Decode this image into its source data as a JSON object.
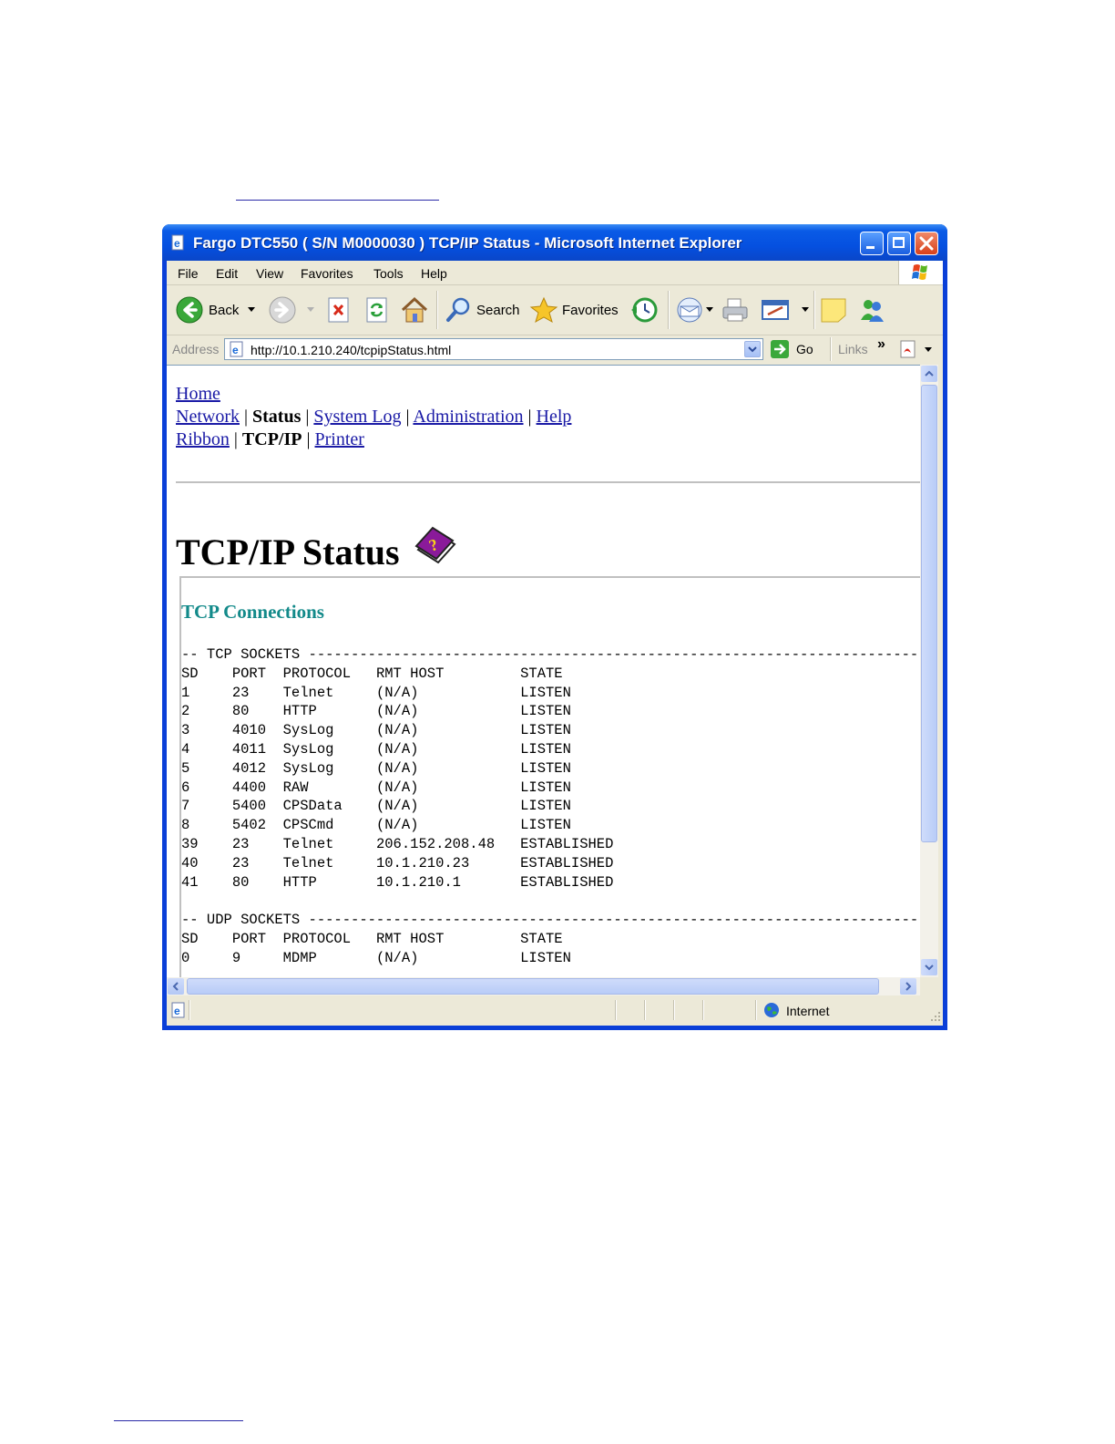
{
  "window": {
    "title": "Fargo DTC550 ( S/N M0000030 ) TCP/IP Status - Microsoft Internet Explorer"
  },
  "menu": [
    "File",
    "Edit",
    "View",
    "Favorites",
    "Tools",
    "Help"
  ],
  "toolbar": {
    "back_label": "Back",
    "search_label": "Search",
    "favorites_label": "Favorites"
  },
  "address": {
    "label": "Address",
    "url": "http://10.1.210.240/tcpipStatus.html",
    "go_label": "Go",
    "links_label": "Links",
    "chevron": "»"
  },
  "nav": {
    "home": "Home",
    "row2": {
      "network": "Network",
      "status": "Status",
      "system_log": "System Log",
      "administration": "Administration",
      "help": "Help"
    },
    "row3": {
      "ribbon": "Ribbon",
      "tcpip": "TCP/IP",
      "printer": "Printer"
    },
    "sep": "|"
  },
  "page": {
    "title": "TCP/IP Status",
    "section": "TCP Connections"
  },
  "tcp_sockets": {
    "heading": "-- TCP SOCKETS ------------------------------------------------------------------------",
    "columns": [
      "SD",
      "PORT",
      "PROTOCOL",
      "RMT HOST",
      "STATE"
    ],
    "rows": [
      [
        "1",
        "23",
        "Telnet",
        "(N/A)",
        "LISTEN"
      ],
      [
        "2",
        "80",
        "HTTP",
        "(N/A)",
        "LISTEN"
      ],
      [
        "3",
        "4010",
        "SysLog",
        "(N/A)",
        "LISTEN"
      ],
      [
        "4",
        "4011",
        "SysLog",
        "(N/A)",
        "LISTEN"
      ],
      [
        "5",
        "4012",
        "SysLog",
        "(N/A)",
        "LISTEN"
      ],
      [
        "6",
        "4400",
        "RAW",
        "(N/A)",
        "LISTEN"
      ],
      [
        "7",
        "5400",
        "CPSData",
        "(N/A)",
        "LISTEN"
      ],
      [
        "8",
        "5402",
        "CPSCmd",
        "(N/A)",
        "LISTEN"
      ],
      [
        "39",
        "23",
        "Telnet",
        "206.152.208.48",
        "ESTABLISHED"
      ],
      [
        "40",
        "23",
        "Telnet",
        "10.1.210.23",
        "ESTABLISHED"
      ],
      [
        "41",
        "80",
        "HTTP",
        "10.1.210.1",
        "ESTABLISHED"
      ]
    ]
  },
  "udp_sockets": {
    "heading": "-- UDP SOCKETS ------------------------------------------------------------------------",
    "columns": [
      "SD",
      "PORT",
      "PROTOCOL",
      "RMT HOST",
      "STATE"
    ],
    "rows": [
      [
        "0",
        "9",
        "MDMP",
        "(N/A)",
        "LISTEN"
      ]
    ]
  },
  "statusbar": {
    "zone": "Internet"
  },
  "colors": {
    "titlebar": "#0550e0",
    "link": "#1a1aa6",
    "section": "#138a8a"
  }
}
